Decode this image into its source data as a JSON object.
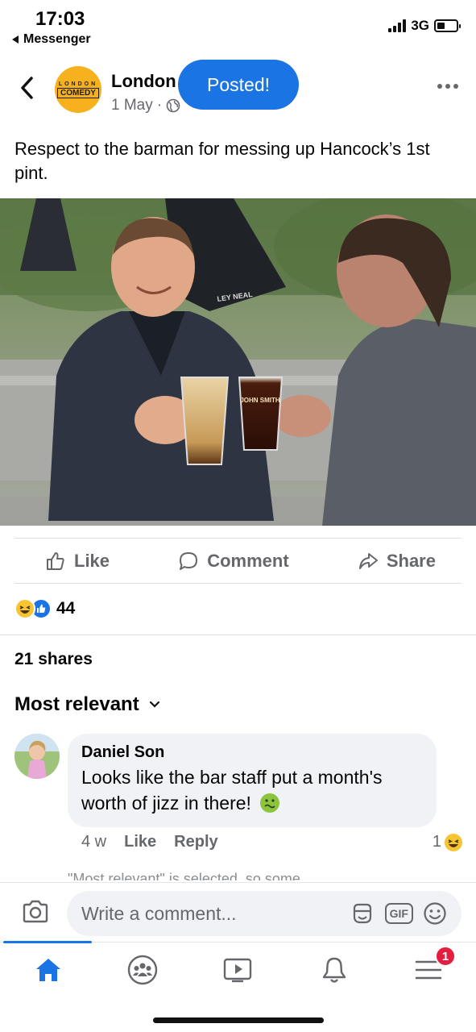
{
  "status_bar": {
    "time": "17:03",
    "back_app": "Messenger",
    "network": "3G",
    "battery_level": 0.4
  },
  "post": {
    "page_name": "London",
    "logo_top": "LONDON",
    "logo_main": "COMEDY",
    "date": "1 May",
    "audience_icon": "globe-icon",
    "toast": "Posted!",
    "text": "Respect to the barman for messing up Hancock’s 1st pint.",
    "photo_description_icon": "photo",
    "photo_text": {
      "glass_brand": "JOHN SMITH",
      "umbrella": "LEY NEAL"
    }
  },
  "actions": {
    "like": "Like",
    "comment": "Comment",
    "share": "Share"
  },
  "reactions": {
    "count": "44",
    "types": [
      "haha",
      "like"
    ]
  },
  "shares": "21 shares",
  "sort": {
    "label": "Most relevant"
  },
  "comments": [
    {
      "author": "Daniel Son",
      "text": "Looks like the bar staff put a month's worth of jizz in there!",
      "emoji": "nauseated-face",
      "time": "4 w",
      "like": "Like",
      "reply": "Reply",
      "reaction_count": "1"
    }
  ],
  "cut_notice": "\"Most relevant\" is selected, so some",
  "composer": {
    "placeholder": "Write a comment...",
    "gif": "GIF"
  },
  "tabs": [
    {
      "name": "home",
      "active": true
    },
    {
      "name": "groups"
    },
    {
      "name": "watch"
    },
    {
      "name": "notifications"
    },
    {
      "name": "menu",
      "badge": "1"
    }
  ],
  "colors": {
    "accent": "#1b74e4",
    "secondary_text": "#65676b",
    "badge": "#e41e3f",
    "logo": "#f6b11c"
  }
}
